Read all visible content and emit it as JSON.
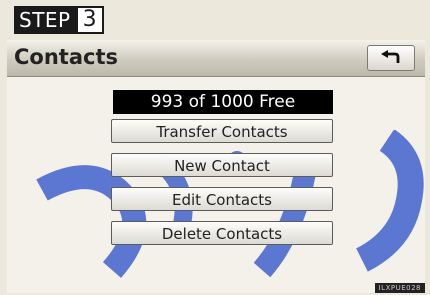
{
  "step": {
    "label": "STEP",
    "number": "3"
  },
  "screen": {
    "title": "Contacts",
    "back_icon": "back-arrow-icon",
    "capacity": "993 of 1000 Free",
    "buttons": [
      "Transfer Contacts",
      "New Contact",
      "Edit Contacts",
      "Delete Contacts"
    ],
    "image_code": "ILXPUE028"
  },
  "colors": {
    "header": "#cfcbbf",
    "screen_bg": "#f3f1ea",
    "capacity_bg": "#000000",
    "watermark": "#3a5ccc"
  }
}
